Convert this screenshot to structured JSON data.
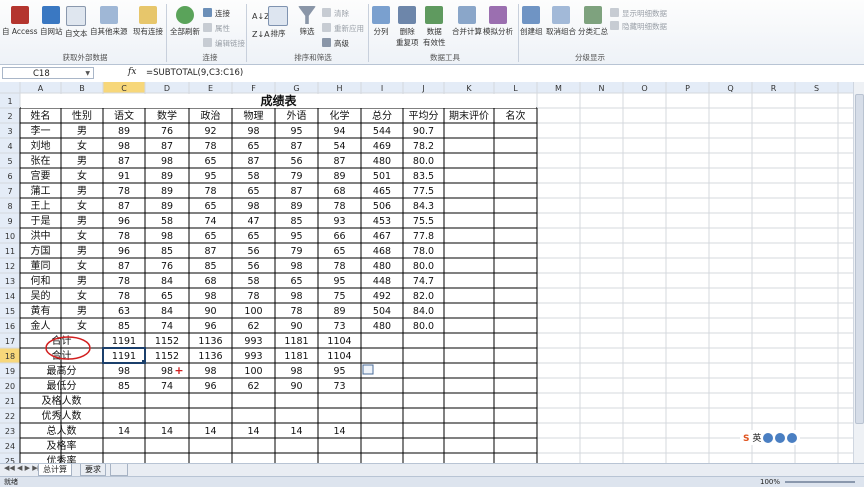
{
  "ribbon": {
    "external": {
      "access": "自 Access",
      "web": "自网站",
      "text": "自文本",
      "other": "自其他来源",
      "existing": "现有连接",
      "group": "获取外部数据"
    },
    "connections": {
      "refresh": "全部刷新",
      "conn": "连接",
      "props": "属性",
      "edit": "编辑链接",
      "group": "连接"
    },
    "sort": {
      "sort": "排序",
      "filter": "筛选",
      "clear": "清除",
      "reapply": "重新应用",
      "advanced": "高级",
      "group": "排序和筛选"
    },
    "tools": {
      "split": "分列",
      "dedup": "删除\n重复项",
      "validate": "数据\n有效性",
      "consolidate": "合并计算",
      "whatif": "模拟分析",
      "group": "数据工具"
    },
    "outline": {
      "group_btn": "创建组",
      "ungroup": "取消组合",
      "subtotal": "分类汇总",
      "show": "显示明细数据",
      "hide": "隐藏明细数据",
      "group": "分级显示"
    }
  },
  "formula_bar": {
    "name_box": "C18",
    "fx": "fx",
    "formula": "=SUBTOTAL(9,C3:C16)"
  },
  "columns": [
    "A",
    "B",
    "C",
    "D",
    "E",
    "F",
    "G",
    "H",
    "I",
    "J",
    "K",
    "L",
    "M",
    "N",
    "O",
    "P",
    "Q",
    "R",
    "S"
  ],
  "rows": [
    "1",
    "2",
    "3",
    "4",
    "5",
    "6",
    "7",
    "8",
    "9",
    "10",
    "11",
    "12",
    "13",
    "14",
    "15",
    "16",
    "17",
    "18",
    "19",
    "20",
    "21",
    "22",
    "23",
    "24",
    "25"
  ],
  "title": "成绩表",
  "headers": [
    "姓名",
    "性别",
    "语文",
    "数学",
    "政治",
    "物理",
    "外语",
    "化学",
    "总分",
    "平均分",
    "期末评价",
    "名次"
  ],
  "students": [
    [
      "李一",
      "男",
      "89",
      "76",
      "92",
      "98",
      "95",
      "94",
      "544",
      "90.7"
    ],
    [
      "刘地",
      "女",
      "98",
      "87",
      "78",
      "65",
      "87",
      "54",
      "469",
      "78.2"
    ],
    [
      "张在",
      "男",
      "87",
      "98",
      "65",
      "87",
      "56",
      "87",
      "480",
      "80.0"
    ],
    [
      "宫要",
      "女",
      "91",
      "89",
      "95",
      "58",
      "79",
      "89",
      "501",
      "83.5"
    ],
    [
      "蒲工",
      "男",
      "78",
      "89",
      "78",
      "65",
      "87",
      "68",
      "465",
      "77.5"
    ],
    [
      "王上",
      "女",
      "87",
      "89",
      "65",
      "98",
      "89",
      "78",
      "506",
      "84.3"
    ],
    [
      "于是",
      "男",
      "96",
      "58",
      "74",
      "47",
      "85",
      "93",
      "453",
      "75.5"
    ],
    [
      "洪中",
      "女",
      "78",
      "98",
      "65",
      "65",
      "95",
      "66",
      "467",
      "77.8"
    ],
    [
      "方国",
      "男",
      "96",
      "85",
      "87",
      "56",
      "79",
      "65",
      "468",
      "78.0"
    ],
    [
      "董同",
      "女",
      "87",
      "76",
      "85",
      "56",
      "98",
      "78",
      "480",
      "80.0"
    ],
    [
      "何和",
      "男",
      "78",
      "84",
      "68",
      "58",
      "65",
      "95",
      "448",
      "74.7"
    ],
    [
      "吴的",
      "女",
      "78",
      "65",
      "98",
      "78",
      "98",
      "75",
      "492",
      "82.0"
    ],
    [
      "黄有",
      "男",
      "63",
      "84",
      "90",
      "100",
      "78",
      "89",
      "504",
      "84.0"
    ],
    [
      "金人",
      "女",
      "85",
      "74",
      "96",
      "62",
      "90",
      "73",
      "480",
      "80.0"
    ]
  ],
  "summary": [
    {
      "label": "合计",
      "values": [
        "1191",
        "1152",
        "1136",
        "993",
        "1181",
        "1104"
      ]
    },
    {
      "label": "合计",
      "values": [
        "1191",
        "1152",
        "1136",
        "993",
        "1181",
        "1104"
      ]
    },
    {
      "label": "最高分",
      "values": [
        "98",
        "98",
        "98",
        "100",
        "98",
        "95"
      ]
    },
    {
      "label": "最低分",
      "values": [
        "85",
        "74",
        "96",
        "62",
        "90",
        "73"
      ]
    },
    {
      "label": "及格人数",
      "values": [
        "",
        "",
        "",
        "",
        "",
        ""
      ]
    },
    {
      "label": "优秀人数",
      "values": [
        "",
        "",
        "",
        "",
        "",
        ""
      ]
    },
    {
      "label": "总人数",
      "values": [
        "14",
        "14",
        "14",
        "14",
        "14",
        "14"
      ]
    },
    {
      "label": "及格率",
      "values": [
        "",
        "",
        "",
        "",
        "",
        ""
      ]
    },
    {
      "label": "优秀率",
      "values": [
        "",
        "",
        "",
        "",
        "",
        ""
      ]
    }
  ],
  "sheet_tabs": [
    "总计算",
    "要求"
  ],
  "status": {
    "ready": "就绪",
    "zoom": "100%"
  },
  "ime": {
    "label": "英"
  },
  "colors": {
    "annotation": "#d21f1f",
    "selected": "#1b3f6b",
    "header_bg": "#e4ecf7",
    "header_hl": "#f7d77a"
  }
}
